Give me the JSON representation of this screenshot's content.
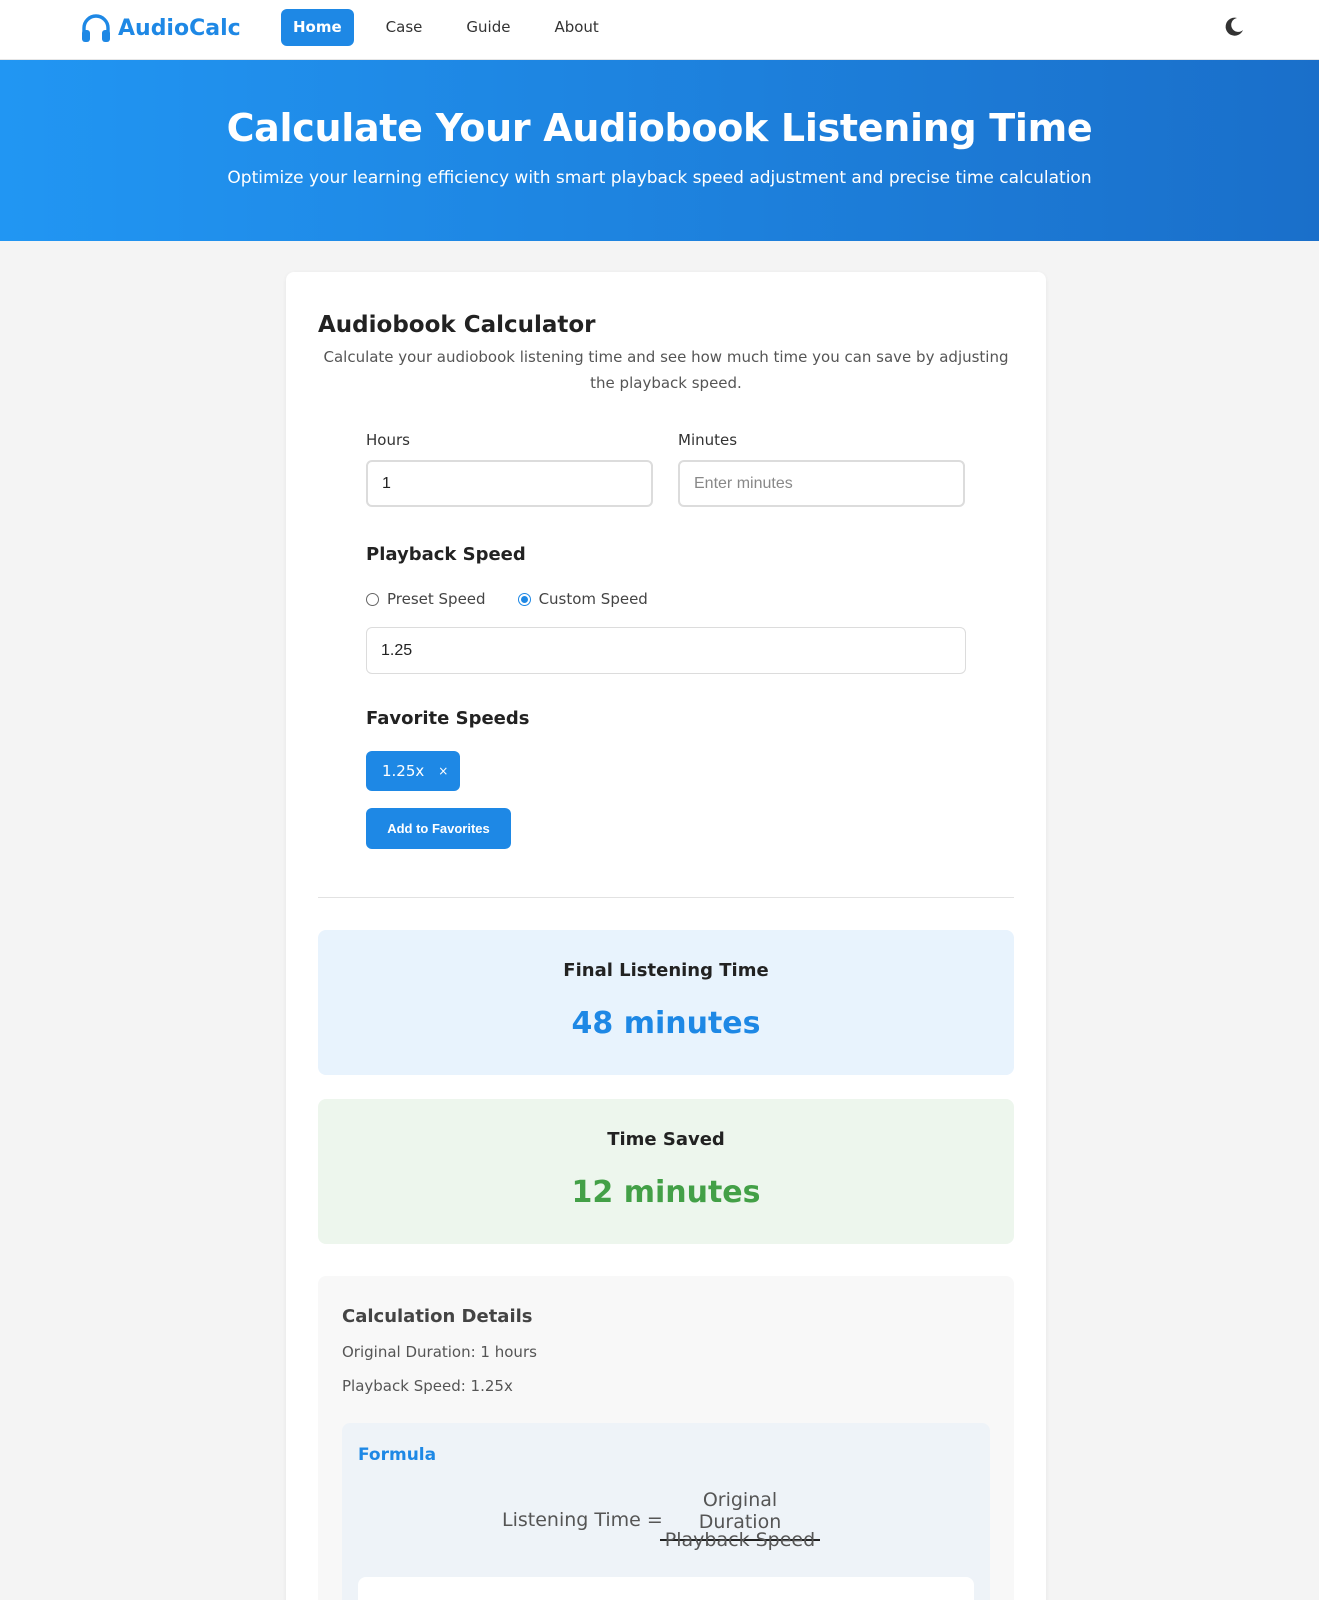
{
  "nav": {
    "brand": "AudioCalc",
    "links": [
      {
        "label": "Home",
        "active": true
      },
      {
        "label": "Case",
        "active": false
      },
      {
        "label": "Guide",
        "active": false
      },
      {
        "label": "About",
        "active": false
      }
    ],
    "theme_icon": "moon-icon",
    "brand_color": "#1e88e5"
  },
  "hero": {
    "title": "Calculate Your Audiobook Listening Time",
    "subtitle": "Optimize your learning efficiency with smart playback speed adjustment and precise time calculation"
  },
  "calculator": {
    "title": "Audiobook Calculator",
    "description": "Calculate your audiobook listening time and see how much time you can save by adjusting the playback speed.",
    "hours_label": "Hours",
    "hours_value": "1",
    "minutes_label": "Minutes",
    "minutes_placeholder": "Enter minutes",
    "playback_heading": "Playback Speed",
    "radio_preset": "Preset Speed",
    "radio_custom": "Custom Speed",
    "selected_mode": "custom",
    "custom_speed_value": "1.25",
    "favorites_heading": "Favorite Speeds",
    "favorites": [
      {
        "label": "1.25x",
        "remove": "×"
      }
    ],
    "add_favorite_label": "Add to Favorites"
  },
  "results": {
    "final_title": "Final Listening Time",
    "final_value": "48 minutes",
    "saved_title": "Time Saved",
    "saved_value": "12 minutes",
    "final_color": "#1e88e5",
    "saved_color": "#43a047"
  },
  "details": {
    "title": "Calculation Details",
    "original": "Original Duration: 1 hours",
    "speed": "Playback Speed: 1.25x",
    "formula_title": "Formula",
    "formula_lhs": "Listening Time =",
    "formula_numerator": "Original Duration",
    "formula_denominator": "Playback Speed"
  }
}
